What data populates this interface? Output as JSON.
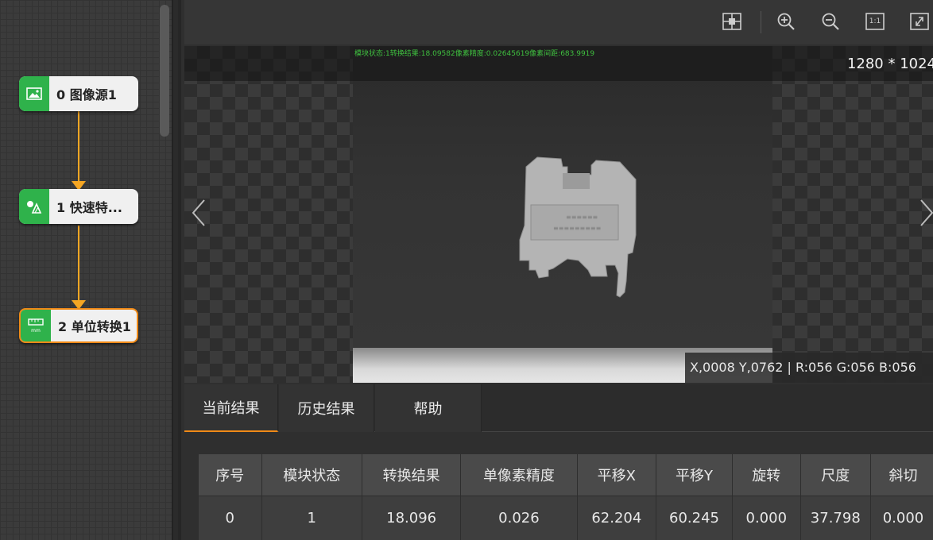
{
  "flow": {
    "nodes": [
      {
        "label": "0 图像源1",
        "icon": "image-source-icon"
      },
      {
        "label": "1 快速特...",
        "icon": "feature-match-icon"
      },
      {
        "label": "2 单位转换1",
        "icon": "unit-convert-icon"
      }
    ]
  },
  "toolbar": {
    "buttons": [
      {
        "icon": "crosshair-grid-icon"
      },
      {
        "icon": "zoom-in-icon"
      },
      {
        "icon": "zoom-out-icon"
      },
      {
        "icon": "actual-size-icon",
        "label": "1:1"
      },
      {
        "icon": "fullscreen-icon"
      }
    ]
  },
  "viewer": {
    "status_text": "模块状态:1转换结果:18.09582像素精度:0.02645619像素间距:683.9919",
    "resolution": "1280 * 1024",
    "pixel_info": "X,0008  Y,0762  |  R:056  G:056  B:056"
  },
  "tabs": [
    {
      "label": "当前结果",
      "active": true
    },
    {
      "label": "历史结果",
      "active": false
    },
    {
      "label": "帮助",
      "active": false
    }
  ],
  "table": {
    "headers": [
      "序号",
      "模块状态",
      "转换结果",
      "单像素精度",
      "平移X",
      "平移Y",
      "旋转",
      "尺度",
      "斜切"
    ],
    "rows": [
      [
        "0",
        "1",
        "18.096",
        "0.026",
        "62.204",
        "60.245",
        "0.000",
        "37.798",
        "0.000"
      ]
    ]
  },
  "colors": {
    "accent": "#f08a17",
    "connector": "#f5a623",
    "node_icon_bg": "#2fb24b",
    "status_text": "#3fbf3f"
  }
}
